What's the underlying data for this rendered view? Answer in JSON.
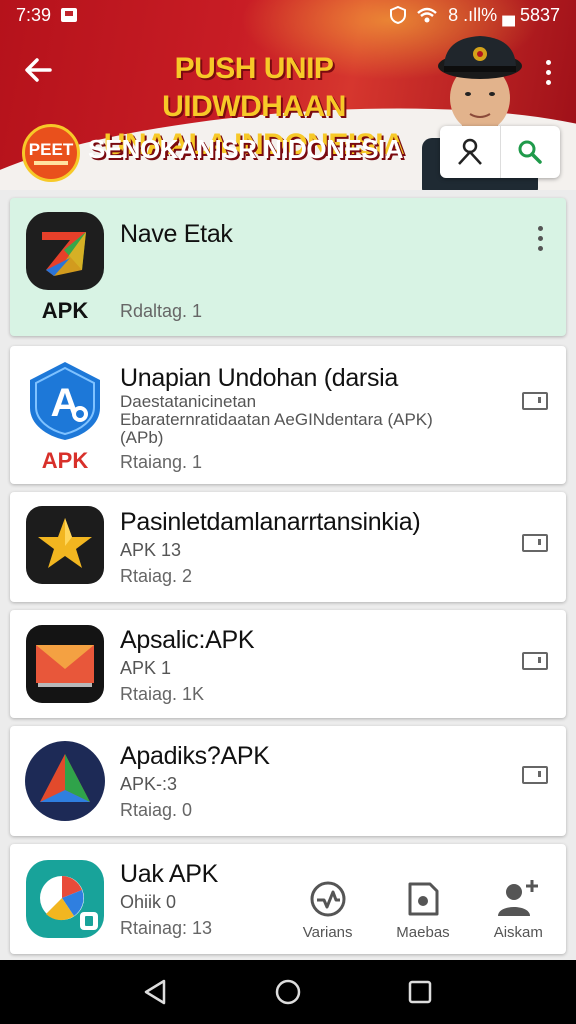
{
  "status_bar": {
    "time": "7:39",
    "right_text": "8 .ıll% ▄ 5837"
  },
  "header": {
    "title_line1": "PUSH UNIP UIDWDHAAN",
    "title_line2": "UNAALA INDONEISIA",
    "subtitle": "SENOKANISR NIDONESIA",
    "badge_text": "PEET",
    "colors": {
      "primary": "#c81d25",
      "gold": "#f7c928"
    }
  },
  "apps": [
    {
      "title": "Nave Etak",
      "tag": "APK",
      "tag_color": "#111111",
      "rating": "Rdaltag. 1",
      "icon": "arrow-logo-icon",
      "selected": true
    },
    {
      "title": "Unapian Undohan (darsia",
      "tag": "APK",
      "tag_color": "#d8302a",
      "meta1": "Daestatanicinetan",
      "meta2": "Ebaraternratidaatan AeGINdentara (APK)",
      "meta3": "(APb)",
      "rating": "Rtaiang. 1",
      "icon": "blue-shield-a-icon"
    },
    {
      "title": "Pasinletdamlanarrtansinkia)",
      "meta1": "APK 13",
      "rating": "Rtaiag. 2",
      "icon": "gold-star-icon"
    },
    {
      "title": "Apsalic:APK",
      "meta1": "APK  1",
      "rating": "Rtaiag. 1K",
      "icon": "mail-envelope-icon"
    },
    {
      "title": "Apadiks?APK",
      "meta1": "APK-:3",
      "rating": "Rtaiag. 0",
      "icon": "triangle-logo-icon"
    },
    {
      "title": "Uak APK",
      "meta1": "Ohiik 0",
      "rating": "Rtainag: 13",
      "icon": "pie-chart-app-icon"
    }
  ],
  "bottom_nav": [
    {
      "label": "Varians",
      "icon": "heart-pulse-icon"
    },
    {
      "label": "Maebas",
      "icon": "document-icon"
    },
    {
      "label": "Aiskam",
      "icon": "person-icon"
    }
  ]
}
